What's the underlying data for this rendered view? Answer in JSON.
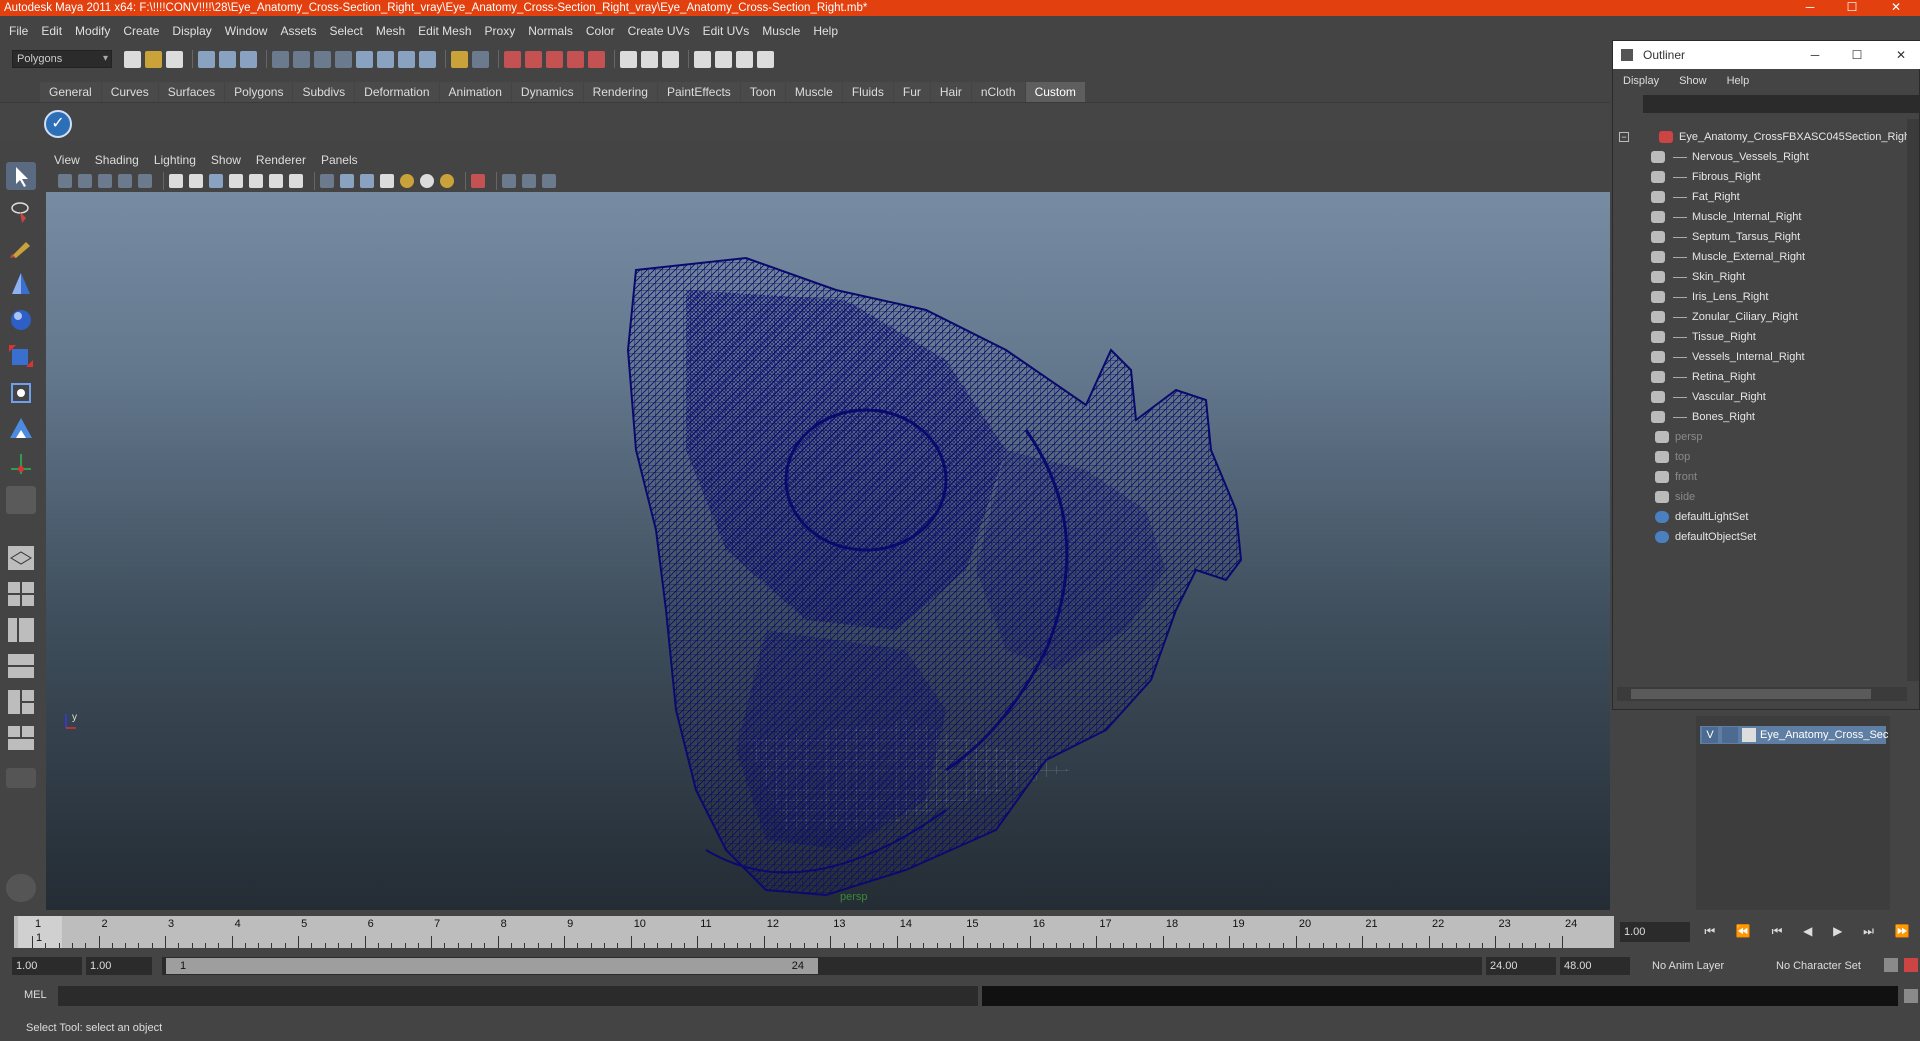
{
  "window": {
    "title": "Autodesk Maya 2011 x64: F:\\!!!!CONV!!!!\\28\\Eye_Anatomy_Cross-Section_Right_vray\\Eye_Anatomy_Cross-Section_Right_vray\\Eye_Anatomy_Cross-Section_Right.mb*",
    "minimize": "─",
    "maximize": "☐",
    "close": "✕"
  },
  "menubar": [
    "File",
    "Edit",
    "Modify",
    "Create",
    "Display",
    "Window",
    "Assets",
    "Select",
    "Mesh",
    "Edit Mesh",
    "Proxy",
    "Normals",
    "Color",
    "Create UVs",
    "Edit UVs",
    "Muscle",
    "Help"
  ],
  "toolbar": {
    "mode": "Polygons"
  },
  "shelf": {
    "tabs": [
      "General",
      "Curves",
      "Surfaces",
      "Polygons",
      "Subdivs",
      "Deformation",
      "Animation",
      "Dynamics",
      "Rendering",
      "PaintEffects",
      "Toon",
      "Muscle",
      "Fluids",
      "Fur",
      "Hair",
      "nCloth",
      "Custom"
    ],
    "active": "Custom"
  },
  "viewport": {
    "menus": [
      "View",
      "Shading",
      "Lighting",
      "Show",
      "Renderer",
      "Panels"
    ],
    "camera_label": "persp",
    "axis_label": "y",
    "mesh_color": "#0a0a6e"
  },
  "timeline": {
    "ticks": [
      "1",
      "2",
      "3",
      "4",
      "5",
      "6",
      "7",
      "8",
      "9",
      "10",
      "11",
      "12",
      "13",
      "14",
      "15",
      "16",
      "17",
      "18",
      "19",
      "20",
      "21",
      "22",
      "23",
      "24"
    ],
    "current_frame": "1",
    "current_field": "1.00"
  },
  "playback": {
    "buttons": [
      "⏮",
      "⏪",
      "⏮",
      "◀",
      "▶",
      "⏭",
      "⏩"
    ]
  },
  "range": {
    "start": "1.00",
    "start2": "1.00",
    "slider_start": "1",
    "slider_end": "24",
    "end": "24.00",
    "end2": "48.00",
    "anim_layer": "No Anim Layer",
    "char_set": "No Character Set"
  },
  "cmd": {
    "label": "MEL"
  },
  "status": {
    "text": "Select Tool: select an object"
  },
  "outliner": {
    "title": "Outliner",
    "menus": [
      "Display",
      "Show",
      "Help"
    ],
    "items": [
      {
        "label": "Eye_Anatomy_CrossFBXASC045Section_Righ",
        "level": 0,
        "dim": false
      },
      {
        "label": "Nervous_Vessels_Right",
        "level": 1,
        "dim": false
      },
      {
        "label": "Fibrous_Right",
        "level": 1,
        "dim": false
      },
      {
        "label": "Fat_Right",
        "level": 1,
        "dim": false
      },
      {
        "label": "Muscle_Internal_Right",
        "level": 1,
        "dim": false
      },
      {
        "label": "Septum_Tarsus_Right",
        "level": 1,
        "dim": false
      },
      {
        "label": "Muscle_External_Right",
        "level": 1,
        "dim": false
      },
      {
        "label": "Skin_Right",
        "level": 1,
        "dim": false
      },
      {
        "label": "Iris_Lens_Right",
        "level": 1,
        "dim": false
      },
      {
        "label": "Zonular_Ciliary_Right",
        "level": 1,
        "dim": false
      },
      {
        "label": "Tissue_Right",
        "level": 1,
        "dim": false
      },
      {
        "label": "Vessels_Internal_Right",
        "level": 1,
        "dim": false
      },
      {
        "label": "Retina_Right",
        "level": 1,
        "dim": false
      },
      {
        "label": "Vascular_Right",
        "level": 1,
        "dim": false
      },
      {
        "label": "Bones_Right",
        "level": 1,
        "dim": false
      },
      {
        "label": "persp",
        "level": 0,
        "dim": true
      },
      {
        "label": "top",
        "level": 0,
        "dim": true
      },
      {
        "label": "front",
        "level": 0,
        "dim": true
      },
      {
        "label": "side",
        "level": 0,
        "dim": true
      },
      {
        "label": "defaultLightSet",
        "level": 0,
        "dim": false
      },
      {
        "label": "defaultObjectSet",
        "level": 0,
        "dim": false
      }
    ]
  },
  "layers": {
    "visible": "V",
    "name": "Eye_Anatomy_Cross_Sec"
  }
}
